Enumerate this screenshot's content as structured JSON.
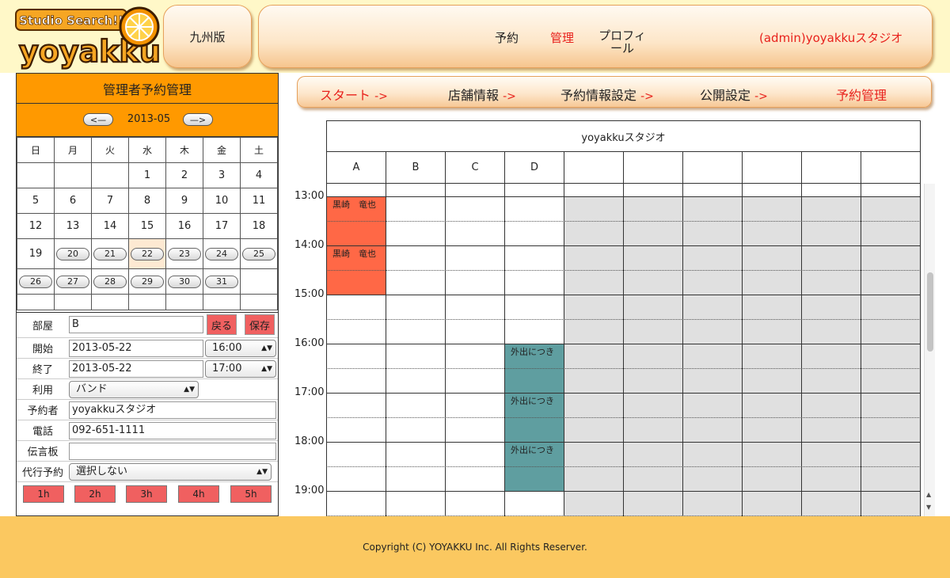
{
  "header": {
    "logo_tagline": "Studio Search!!",
    "logo_name": "yoyakku",
    "region": "九州版",
    "nav": {
      "reserve": "予約",
      "manage": "管理",
      "profile": "プロフィール",
      "user": "(admin)yoyakkuスタジオ"
    }
  },
  "left_panel": {
    "title": "管理者予約管理",
    "prev": "<—",
    "next": "—>",
    "month": "2013-05",
    "weekdays": [
      "日",
      "月",
      "火",
      "水",
      "木",
      "金",
      "土"
    ],
    "days": [
      "1",
      "2",
      "3",
      "4",
      "5",
      "6",
      "7",
      "8",
      "9",
      "10",
      "11",
      "12",
      "13",
      "14",
      "15",
      "16",
      "17",
      "18",
      "19",
      "20",
      "21",
      "22",
      "23",
      "24",
      "25",
      "26",
      "27",
      "28",
      "29",
      "30",
      "31"
    ]
  },
  "form": {
    "room_label": "部屋",
    "room_value": "B",
    "back": "戻る",
    "save": "保存",
    "start_label": "開始",
    "start_date": "2013-05-22",
    "start_time": "16:00",
    "end_label": "終了",
    "end_date": "2013-05-22",
    "end_time": "17:00",
    "use_label": "利用",
    "use_value": "バンド",
    "booker_label": "予約者",
    "booker_value": "yoyakkuスタジオ",
    "phone_label": "電話",
    "phone_value": "092-651-1111",
    "memo_label": "伝言板",
    "memo_value": "",
    "proxy_label": "代行予約",
    "proxy_value": "選択しない",
    "hours": [
      "1h",
      "2h",
      "3h",
      "4h",
      "5h"
    ]
  },
  "steps": {
    "s1": "スタート",
    "s2": "店舗情報",
    "s3": "予約情報設定",
    "s4": "公開設定",
    "s5": "予約管理",
    "arrow": "->"
  },
  "schedule": {
    "studio": "yoyakkuスタジオ",
    "columns": [
      "A",
      "B",
      "C",
      "D",
      "",
      "",
      "",
      "",
      "",
      ""
    ],
    "times": [
      "13:00",
      "14:00",
      "15:00",
      "16:00",
      "17:00",
      "18:00",
      "19:00"
    ],
    "bookings": [
      {
        "col": "A",
        "start": "13:00",
        "end": "14:00",
        "label": "黒崎　竜也",
        "color": "#ff6846"
      },
      {
        "col": "A",
        "start": "14:00",
        "end": "15:00",
        "label": "黒崎　竜也",
        "color": "#ff6846"
      },
      {
        "col": "D",
        "start": "16:00",
        "end": "17:00",
        "label": "外出につき",
        "color": "#5f9ea0"
      },
      {
        "col": "D",
        "start": "17:00",
        "end": "18:00",
        "label": "外出につき",
        "color": "#5f9ea0"
      },
      {
        "col": "D",
        "start": "18:00",
        "end": "19:00",
        "label": "外出につき",
        "color": "#5f9ea0"
      }
    ],
    "unavailable_color": "#e0e0e0"
  },
  "footer": {
    "copyright": "Copyright (C) YOYAKKU Inc. All Rights Reserver."
  }
}
